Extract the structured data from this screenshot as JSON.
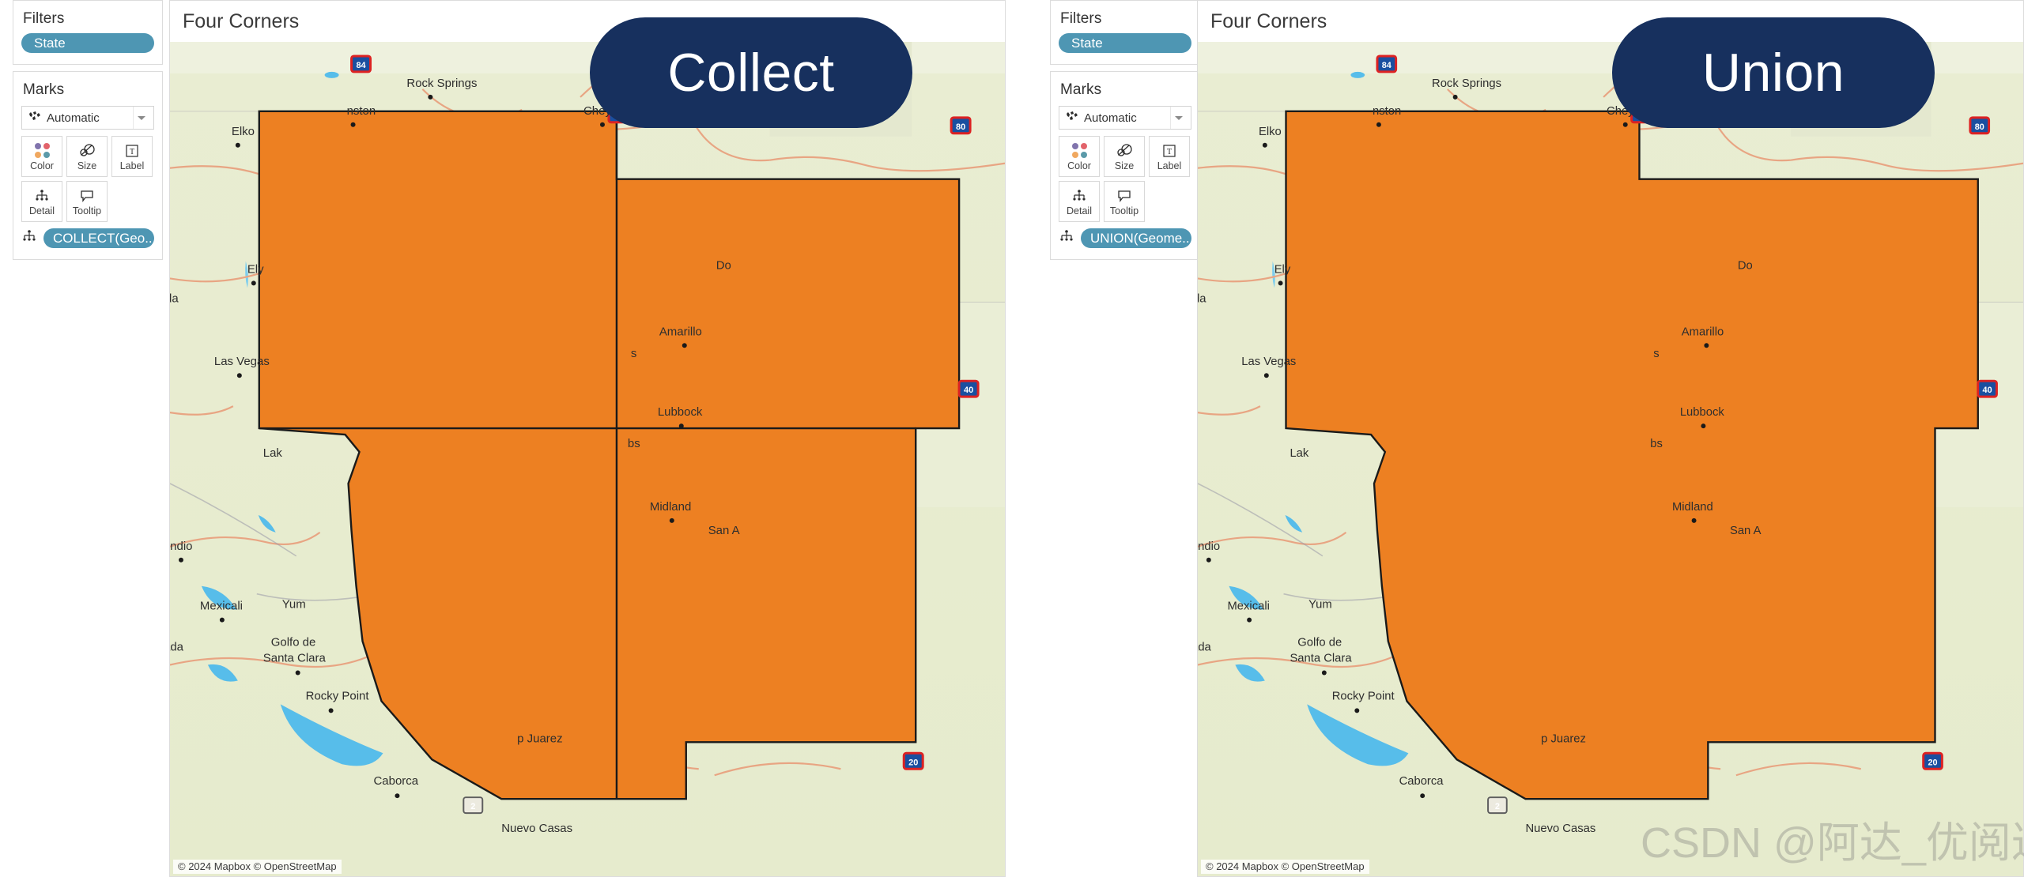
{
  "panes": [
    {
      "key": "collect",
      "badge_label": "Collect",
      "viz_title": "Four Corners",
      "filters": {
        "title": "Filters",
        "pills": [
          "State"
        ]
      },
      "marks": {
        "title": "Marks",
        "type_label": "Automatic",
        "type_icon": "map-mark-icon",
        "buttons": [
          {
            "label": "Color",
            "icon": "color-dots-icon"
          },
          {
            "label": "Size",
            "icon": "size-circles-icon"
          },
          {
            "label": "Label",
            "icon": "label-text-icon"
          },
          {
            "label": "Detail",
            "icon": "detail-hierarchy-icon"
          },
          {
            "label": "Tooltip",
            "icon": "tooltip-bubble-icon"
          }
        ],
        "field_pill": {
          "label": "COLLECT(Geo..",
          "icon": "detail-hierarchy-icon"
        }
      },
      "map": {
        "attribution": "© 2024 Mapbox © OpenStreetMap",
        "internal_borders": true
      }
    },
    {
      "key": "union",
      "badge_label": "Union",
      "viz_title": "Four Corners",
      "filters": {
        "title": "Filters",
        "pills": [
          "State"
        ]
      },
      "marks": {
        "title": "Marks",
        "type_label": "Automatic",
        "type_icon": "map-mark-icon",
        "buttons": [
          {
            "label": "Color",
            "icon": "color-dots-icon"
          },
          {
            "label": "Size",
            "icon": "size-circles-icon"
          },
          {
            "label": "Label",
            "icon": "label-text-icon"
          },
          {
            "label": "Detail",
            "icon": "detail-hierarchy-icon"
          },
          {
            "label": "Tooltip",
            "icon": "tooltip-bubble-icon"
          }
        ],
        "field_pill": {
          "label": "UNION(Geome..",
          "icon": "detail-hierarchy-icon"
        }
      },
      "map": {
        "attribution": "© 2024 Mapbox © OpenStreetMap",
        "internal_borders": false
      }
    }
  ],
  "map_labels": {
    "cities": [
      "Elko",
      "Ely",
      "Rock Springs",
      "Cheyenne",
      "nston",
      "Las Vegas",
      "Lak",
      "Indio",
      "Mexicali",
      "Yum",
      "ada",
      "Golfo de",
      "Santa Clara",
      "Rocky Point",
      "Caborca",
      "Nuevo Casas",
      "Amarillo",
      "Lubbock",
      "Midland",
      "San A",
      "bs",
      "s",
      "Do",
      "da"
    ],
    "highway_shields": [
      "84",
      "80",
      "40",
      "20",
      "2"
    ]
  },
  "watermark": "CSDN @阿达_优阅达",
  "colors": {
    "shape_fill": "#ED8022",
    "shape_stroke": "#1a1a1a",
    "badge_bg": "#17305e",
    "pill_bg": "#4e96b3",
    "map_land": "#e8ecd0",
    "map_land_alt": "#eef0dc",
    "map_water": "#57bdea",
    "map_road": "#e8a583",
    "panel_border": "#dcdcdc"
  }
}
